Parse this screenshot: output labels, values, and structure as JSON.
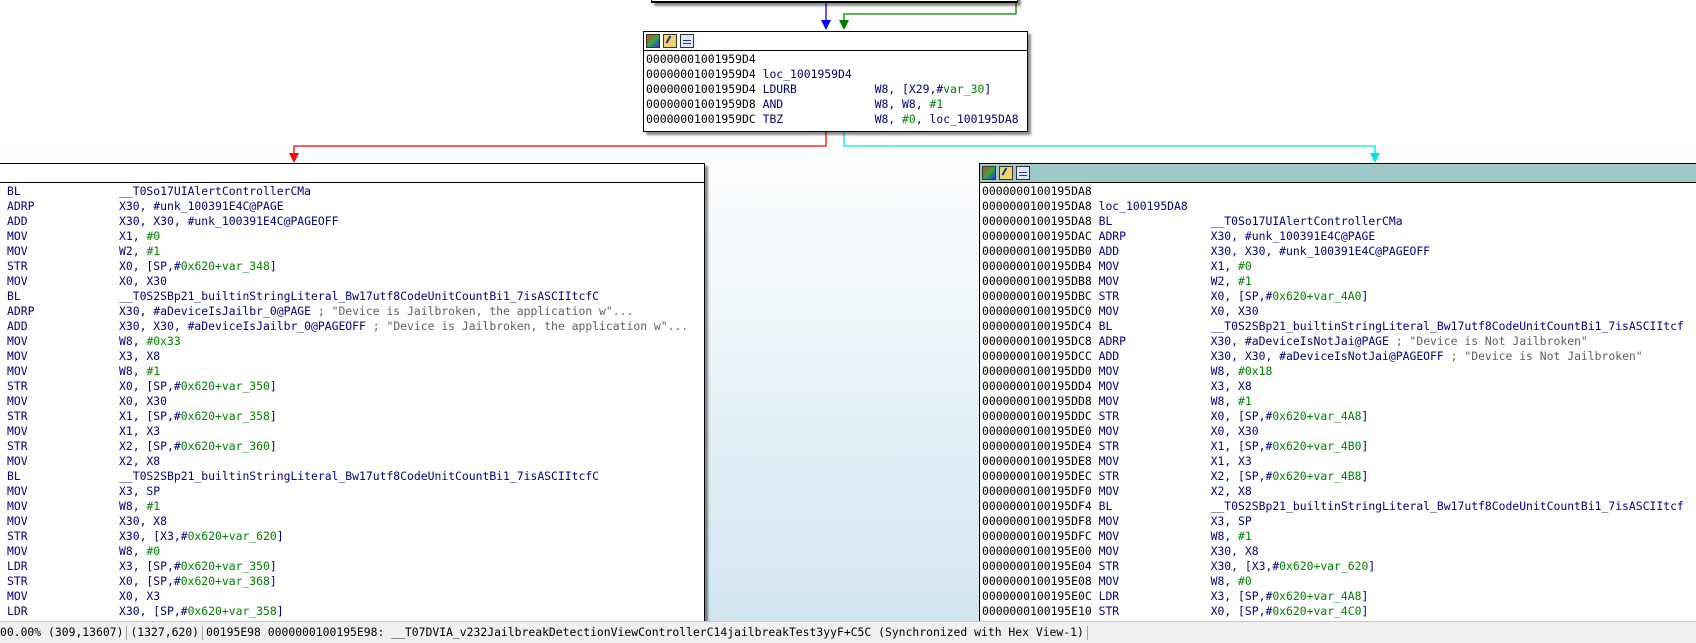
{
  "colors": {
    "edge_true": "#0000ff",
    "edge_false": "#ff0000",
    "edge_green": "#008000",
    "edge_cyan": "#00ffff",
    "graph_bg_bottom": "#d2e6f0",
    "header_selected": "#9fc8c8"
  },
  "icons": [
    "graph-overview-icon",
    "edit-function-icon",
    "xrefs-graph-icon"
  ],
  "top_block": {
    "lines": [
      {
        "addr": "00000001001959D4",
        "mn": "",
        "ops": ""
      },
      {
        "addr": "00000001001959D4",
        "label": "loc_1001959D4"
      },
      {
        "addr": "00000001001959D4",
        "mn": "LDURB",
        "ops": "W8, [X29,#",
        "imm": "var_30",
        "tail": "]"
      },
      {
        "addr": "00000001001959D8",
        "mn": "AND",
        "ops": "W8, W8, ",
        "imm": "#1",
        "tail": ""
      },
      {
        "addr": "00000001001959DC",
        "mn": "TBZ",
        "ops": "W8, ",
        "imm": "#0",
        "tail": ", loc_100195DA8"
      }
    ]
  },
  "left_block": {
    "lines": [
      {
        "mn": "BL",
        "ops": "__T0So17UIAlertControllerCMa",
        "imm": "",
        "tail": ""
      },
      {
        "mn": "ADRP",
        "ops": "X30, #unk_100391E4C@PAGE",
        "imm": "",
        "tail": ""
      },
      {
        "mn": "ADD",
        "ops": "X30, X30, #unk_100391E4C@PAGEOFF",
        "imm": "",
        "tail": ""
      },
      {
        "mn": "MOV",
        "ops": "X1, ",
        "imm": "#0",
        "tail": ""
      },
      {
        "mn": "MOV",
        "ops": "W2, ",
        "imm": "#1",
        "tail": ""
      },
      {
        "mn": "STR",
        "ops": "X0, [SP,#",
        "imm": "0x620+var_348",
        "tail": "]"
      },
      {
        "mn": "MOV",
        "ops": "X0, X30",
        "imm": "",
        "tail": ""
      },
      {
        "mn": "BL",
        "ops": "__T0S2SBp21_builtinStringLiteral_Bw17utf8CodeUnitCountBi1_7isASCIItcfC",
        "imm": "",
        "tail": ""
      },
      {
        "mn": "ADRP",
        "ops": "X30, #aDeviceIsJailbr_0@PAGE ",
        "imm": "",
        "tail": "",
        "comment": "; \"Device is Jailbroken, the application w\"..."
      },
      {
        "mn": "ADD",
        "ops": "X30, X30, #aDeviceIsJailbr_0@PAGEOFF ",
        "imm": "",
        "tail": "",
        "comment": "; \"Device is Jailbroken, the application w\"..."
      },
      {
        "mn": "MOV",
        "ops": "W8, ",
        "imm": "#0x33",
        "tail": ""
      },
      {
        "mn": "MOV",
        "ops": "X3, X8",
        "imm": "",
        "tail": ""
      },
      {
        "mn": "MOV",
        "ops": "W8, ",
        "imm": "#1",
        "tail": ""
      },
      {
        "mn": "STR",
        "ops": "X0, [SP,#",
        "imm": "0x620+var_350",
        "tail": "]"
      },
      {
        "mn": "MOV",
        "ops": "X0, X30",
        "imm": "",
        "tail": ""
      },
      {
        "mn": "STR",
        "ops": "X1, [SP,#",
        "imm": "0x620+var_358",
        "tail": "]"
      },
      {
        "mn": "MOV",
        "ops": "X1, X3",
        "imm": "",
        "tail": ""
      },
      {
        "mn": "STR",
        "ops": "X2, [SP,#",
        "imm": "0x620+var_360",
        "tail": "]"
      },
      {
        "mn": "MOV",
        "ops": "X2, X8",
        "imm": "",
        "tail": ""
      },
      {
        "mn": "BL",
        "ops": "__T0S2SBp21_builtinStringLiteral_Bw17utf8CodeUnitCountBi1_7isASCIItcfC",
        "imm": "",
        "tail": ""
      },
      {
        "mn": "MOV",
        "ops": "X3, SP",
        "imm": "",
        "tail": ""
      },
      {
        "mn": "MOV",
        "ops": "W8, ",
        "imm": "#1",
        "tail": ""
      },
      {
        "mn": "MOV",
        "ops": "X30, X8",
        "imm": "",
        "tail": ""
      },
      {
        "mn": "STR",
        "ops": "X30, [X3,#",
        "imm": "0x620+var_620",
        "tail": "]"
      },
      {
        "mn": "MOV",
        "ops": "W8, ",
        "imm": "#0",
        "tail": ""
      },
      {
        "mn": "LDR",
        "ops": "X3, [SP,#",
        "imm": "0x620+var_350",
        "tail": "]"
      },
      {
        "mn": "STR",
        "ops": "X0, [SP,#",
        "imm": "0x620+var_368",
        "tail": "]"
      },
      {
        "mn": "MOV",
        "ops": "X0, X3",
        "imm": "",
        "tail": ""
      },
      {
        "mn": "LDR",
        "ops": "X30, [SP,#",
        "imm": "0x620+var_358",
        "tail": "]"
      }
    ]
  },
  "right_block": {
    "lines": [
      {
        "addr": "0000000100195DA8",
        "mn": "",
        "ops": ""
      },
      {
        "addr": "0000000100195DA8",
        "label": "loc_100195DA8"
      },
      {
        "addr": "0000000100195DA8",
        "mn": "BL",
        "ops": "__T0So17UIAlertControllerCMa",
        "imm": "",
        "tail": ""
      },
      {
        "addr": "0000000100195DAC",
        "mn": "ADRP",
        "ops": "X30, #unk_100391E4C@PAGE",
        "imm": "",
        "tail": ""
      },
      {
        "addr": "0000000100195DB0",
        "mn": "ADD",
        "ops": "X30, X30, #unk_100391E4C@PAGEOFF",
        "imm": "",
        "tail": ""
      },
      {
        "addr": "0000000100195DB4",
        "mn": "MOV",
        "ops": "X1, ",
        "imm": "#0",
        "tail": ""
      },
      {
        "addr": "0000000100195DB8",
        "mn": "MOV",
        "ops": "W2, ",
        "imm": "#1",
        "tail": ""
      },
      {
        "addr": "0000000100195DBC",
        "mn": "STR",
        "ops": "X0, [SP,#",
        "imm": "0x620+var_4A0",
        "tail": "]"
      },
      {
        "addr": "0000000100195DC0",
        "mn": "MOV",
        "ops": "X0, X30",
        "imm": "",
        "tail": ""
      },
      {
        "addr": "0000000100195DC4",
        "mn": "BL",
        "ops": "__T0S2SBp21_builtinStringLiteral_Bw17utf8CodeUnitCountBi1_7isASCIItcf",
        "imm": "",
        "tail": ""
      },
      {
        "addr": "0000000100195DC8",
        "mn": "ADRP",
        "ops": "X30, #aDeviceIsNotJai@PAGE ",
        "imm": "",
        "tail": "",
        "comment": "; \"Device is Not Jailbroken\""
      },
      {
        "addr": "0000000100195DCC",
        "mn": "ADD",
        "ops": "X30, X30, #aDeviceIsNotJai@PAGEOFF ",
        "imm": "",
        "tail": "",
        "comment": "; \"Device is Not Jailbroken\""
      },
      {
        "addr": "0000000100195DD0",
        "mn": "MOV",
        "ops": "W8, ",
        "imm": "#0x18",
        "tail": ""
      },
      {
        "addr": "0000000100195DD4",
        "mn": "MOV",
        "ops": "X3, X8",
        "imm": "",
        "tail": ""
      },
      {
        "addr": "0000000100195DD8",
        "mn": "MOV",
        "ops": "W8, ",
        "imm": "#1",
        "tail": ""
      },
      {
        "addr": "0000000100195DDC",
        "mn": "STR",
        "ops": "X0, [SP,#",
        "imm": "0x620+var_4A8",
        "tail": "]"
      },
      {
        "addr": "0000000100195DE0",
        "mn": "MOV",
        "ops": "X0, X30",
        "imm": "",
        "tail": ""
      },
      {
        "addr": "0000000100195DE4",
        "mn": "STR",
        "ops": "X1, [SP,#",
        "imm": "0x620+var_4B0",
        "tail": "]"
      },
      {
        "addr": "0000000100195DE8",
        "mn": "MOV",
        "ops": "X1, X3",
        "imm": "",
        "tail": ""
      },
      {
        "addr": "0000000100195DEC",
        "mn": "STR",
        "ops": "X2, [SP,#",
        "imm": "0x620+var_4B8",
        "tail": "]"
      },
      {
        "addr": "0000000100195DF0",
        "mn": "MOV",
        "ops": "X2, X8",
        "imm": "",
        "tail": ""
      },
      {
        "addr": "0000000100195DF4",
        "mn": "BL",
        "ops": "__T0S2SBp21_builtinStringLiteral_Bw17utf8CodeUnitCountBi1_7isASCIItcf",
        "imm": "",
        "tail": ""
      },
      {
        "addr": "0000000100195DF8",
        "mn": "MOV",
        "ops": "X3, SP",
        "imm": "",
        "tail": ""
      },
      {
        "addr": "0000000100195DFC",
        "mn": "MOV",
        "ops": "W8, ",
        "imm": "#1",
        "tail": ""
      },
      {
        "addr": "0000000100195E00",
        "mn": "MOV",
        "ops": "X30, X8",
        "imm": "",
        "tail": ""
      },
      {
        "addr": "0000000100195E04",
        "mn": "STR",
        "ops": "X30, [X3,#",
        "imm": "0x620+var_620",
        "tail": "]"
      },
      {
        "addr": "0000000100195E08",
        "mn": "MOV",
        "ops": "W8, ",
        "imm": "#0",
        "tail": ""
      },
      {
        "addr": "0000000100195E0C",
        "mn": "LDR",
        "ops": "X3, [SP,#",
        "imm": "0x620+var_4A8",
        "tail": "]"
      },
      {
        "addr": "0000000100195E10",
        "mn": "STR",
        "ops": "X0, [SP,#",
        "imm": "0x620+var_4C0",
        "tail": "]"
      }
    ]
  },
  "status_bar": {
    "zoom": "00.00%",
    "graph_coords": "(309,13607)",
    "mouse_coords": "(1327,620)",
    "file_offset": "00195E98",
    "location": "0000000100195E98: __T07DVIA_v232JailbreakDetectionViewControllerC14jailbreakTest3yyF+C5C",
    "sync": "(Synchronized with Hex View-1)"
  }
}
